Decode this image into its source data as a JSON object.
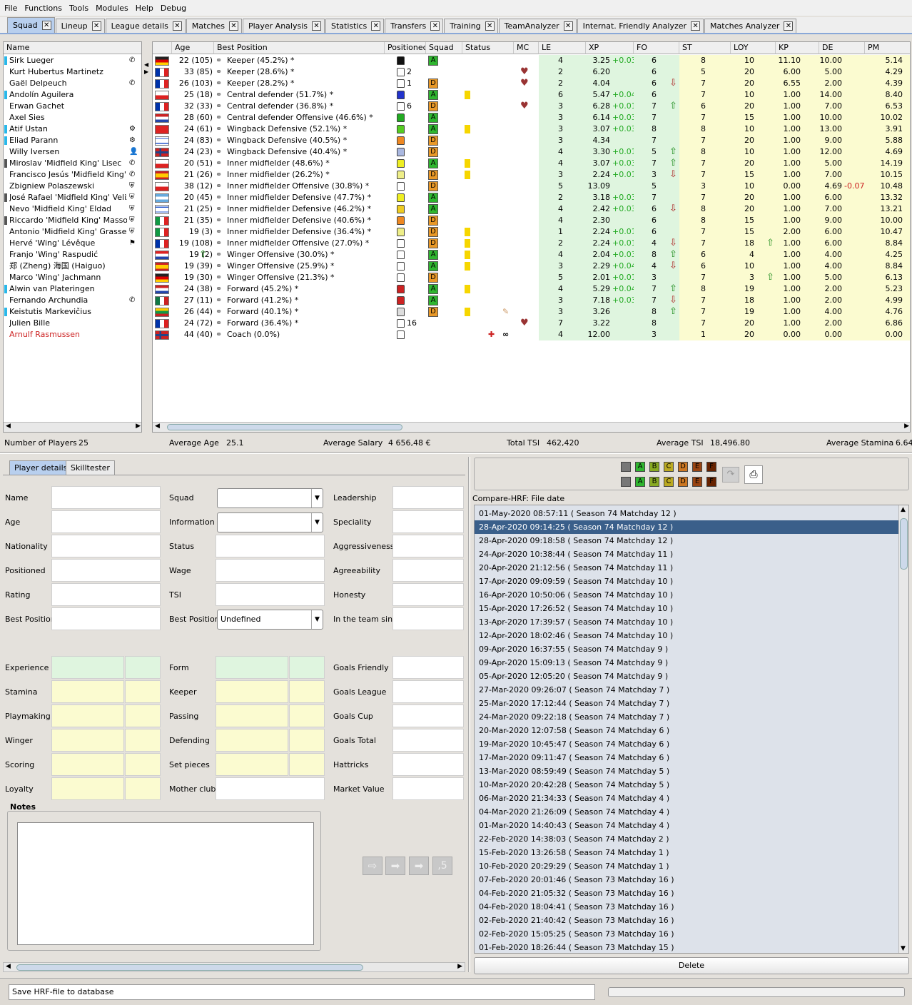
{
  "menu": [
    "File",
    "Functions",
    "Tools",
    "Modules",
    "Help",
    "Debug"
  ],
  "tabs": [
    "Squad",
    "Lineup",
    "League details",
    "Matches",
    "Player Analysis",
    "Statistics",
    "Transfers",
    "Training",
    "TeamAnalyzer",
    "Internat. Friendly Analyzer",
    "Matches Analyzer"
  ],
  "name_header": "Name",
  "columns": {
    "age": "Age",
    "best_position": "Best Position",
    "positioned": "Positioned",
    "squad": "Squad",
    "status": "Status",
    "mc": "MC",
    "le": "LE",
    "xp": "XP",
    "fo": "FO",
    "st": "ST",
    "loy": "LOY",
    "kp": "KP",
    "de": "DE",
    "pm": "PM"
  },
  "players": [
    {
      "name": "Sirk Lueger",
      "marker": "#29b7e8",
      "flag": "de",
      "age": "22 (105)",
      "best": "Keeper (45.2%) *",
      "shirt": "#111111",
      "num": "",
      "grp": "A",
      "card": false,
      "heart": false,
      "le": "4",
      "xp": "3.25",
      "xpd": "+0.03",
      "fo": "6",
      "fa": "",
      "st": "8",
      "loy": "10",
      "la": "",
      "kp": "11.10",
      "de": "10.00",
      "ded": "",
      "pm": "5.14"
    },
    {
      "name": "Kurt Hubertus Martinetz",
      "marker": "",
      "flag": "fr",
      "age": "33 (85)",
      "best": "Keeper (28.6%) *",
      "shirt": "#ffffff",
      "num": "2",
      "grp": "",
      "card": false,
      "heart": true,
      "le": "2",
      "xp": "6.20",
      "xpd": "",
      "fo": "6",
      "fa": "",
      "st": "5",
      "loy": "20",
      "la": "",
      "kp": "6.00",
      "de": "5.00",
      "ded": "",
      "pm": "4.29"
    },
    {
      "name": "Gaël Delpeuch",
      "marker": "",
      "flag": "fr",
      "age": "26 (103)",
      "best": "Keeper (28.2%) *",
      "shirt": "#ffffff",
      "num": "1",
      "grp": "D",
      "card": false,
      "heart": true,
      "le": "2",
      "xp": "4.04",
      "xpd": "",
      "fo": "6",
      "fa": "down",
      "st": "7",
      "loy": "20",
      "la": "",
      "kp": "6.55",
      "de": "2.00",
      "ded": "",
      "pm": "4.39"
    },
    {
      "name": "Andolín Aguilera",
      "marker": "#29b7e8",
      "flag": "cl",
      "age": "25 (18)",
      "best": "Central defender (51.7%) *",
      "shirt": "#2233cc",
      "num": "",
      "grp": "A",
      "card": true,
      "heart": false,
      "le": "6",
      "xp": "5.47",
      "xpd": "+0.04",
      "fo": "6",
      "fa": "",
      "st": "7",
      "loy": "10",
      "la": "",
      "kp": "1.00",
      "de": "14.00",
      "ded": "",
      "pm": "8.40"
    },
    {
      "name": "Erwan Gachet",
      "marker": "",
      "flag": "fr",
      "age": "32 (33)",
      "best": "Central defender (36.8%) *",
      "shirt": "#ffffff",
      "num": "6",
      "grp": "D",
      "card": false,
      "heart": true,
      "le": "3",
      "xp": "6.28",
      "xpd": "+0.01",
      "fo": "7",
      "fa": "up",
      "st": "6",
      "loy": "20",
      "la": "",
      "kp": "1.00",
      "de": "7.00",
      "ded": "",
      "pm": "6.53"
    },
    {
      "name": "Axel Sies",
      "marker": "",
      "flag": "nl",
      "age": "28 (60)",
      "best": "Central defender Offensive (46.6%) *",
      "shirt": "#22aa22",
      "num": "",
      "grp": "A",
      "card": false,
      "heart": false,
      "le": "3",
      "xp": "6.14",
      "xpd": "+0.03",
      "fo": "7",
      "fa": "",
      "st": "7",
      "loy": "15",
      "la": "",
      "kp": "1.00",
      "de": "10.00",
      "ded": "",
      "pm": "10.02"
    },
    {
      "name": "Atif Ustan",
      "marker": "#29b7e8",
      "flag": "tr",
      "age": "24 (61)",
      "best": "Wingback Defensive (52.1%) *",
      "shirt": "#55cc22",
      "num": "",
      "grp": "A",
      "card": true,
      "heart": false,
      "le": "3",
      "xp": "3.07",
      "xpd": "+0.03",
      "fo": "8",
      "fa": "",
      "st": "8",
      "loy": "10",
      "la": "",
      "kp": "1.00",
      "de": "13.00",
      "ded": "",
      "pm": "3.91"
    },
    {
      "name": "Eliad Parann",
      "marker": "#29b7e8",
      "flag": "il",
      "age": "24 (83)",
      "best": "Wingback Defensive (40.5%) *",
      "shirt": "#ee8822",
      "num": "",
      "grp": "D",
      "card": false,
      "heart": false,
      "le": "3",
      "xp": "4.34",
      "xpd": "",
      "fo": "7",
      "fa": "",
      "st": "7",
      "loy": "20",
      "la": "",
      "kp": "1.00",
      "de": "9.00",
      "ded": "",
      "pm": "5.88"
    },
    {
      "name": "Willy Iversen",
      "marker": "",
      "flag": "no",
      "age": "24 (23)",
      "best": "Wingback Defensive (40.4%) *",
      "shirt": "#aab8e0",
      "num": "",
      "grp": "D",
      "card": false,
      "heart": false,
      "le": "4",
      "xp": "3.30",
      "xpd": "+0.01",
      "fo": "5",
      "fa": "up",
      "st": "8",
      "loy": "10",
      "la": "",
      "kp": "1.00",
      "de": "12.00",
      "ded": "",
      "pm": "4.69"
    },
    {
      "name": "Miroslav 'Midfield King' Lisec",
      "marker": "#555555",
      "flag": "cz",
      "age": "20 (51)",
      "best": "Inner midfielder (48.6%) *",
      "shirt": "#eeee22",
      "num": "",
      "grp": "A",
      "card": true,
      "heart": false,
      "le": "4",
      "xp": "3.07",
      "xpd": "+0.03",
      "fo": "7",
      "fa": "up",
      "st": "7",
      "loy": "20",
      "la": "",
      "kp": "1.00",
      "de": "5.00",
      "ded": "",
      "pm": "14.19"
    },
    {
      "name": "Francisco Jesús 'Midfield King' ...",
      "marker": "",
      "flag": "es",
      "age": "21 (26)",
      "best": "Inner midfielder (26.2%) *",
      "shirt": "#eeee88",
      "num": "",
      "grp": "D",
      "card": true,
      "heart": false,
      "le": "3",
      "xp": "2.24",
      "xpd": "+0.01",
      "fo": "3",
      "fa": "down",
      "st": "7",
      "loy": "15",
      "la": "",
      "kp": "1.00",
      "de": "7.00",
      "ded": "",
      "pm": "10.15"
    },
    {
      "name": "Zbigniew Polaszewski",
      "marker": "",
      "flag": "pl",
      "age": "38 (12)",
      "best": "Inner midfielder Offensive (30.8%) *",
      "shirt": "#ffffff",
      "num": "",
      "grp": "D",
      "card": false,
      "heart": false,
      "le": "5",
      "xp": "13.09",
      "xpd": "",
      "fo": "5",
      "fa": "",
      "st": "3",
      "loy": "10",
      "la": "",
      "kp": "0.00",
      "de": "4.69",
      "ded": "-0.07",
      "pm": "10.48"
    },
    {
      "name": "José Rafael 'Midfield King' Veliz",
      "marker": "#555555",
      "flag": "ar",
      "age": "20 (45)",
      "best": "Inner midfielder Defensive (47.7%) *",
      "shirt": "#eeee22",
      "num": "",
      "grp": "A",
      "card": false,
      "heart": false,
      "le": "2",
      "xp": "3.18",
      "xpd": "+0.03",
      "fo": "7",
      "fa": "",
      "st": "7",
      "loy": "20",
      "la": "",
      "kp": "1.00",
      "de": "6.00",
      "ded": "",
      "pm": "13.32"
    },
    {
      "name": "Nevo 'Midfield King' Eldad",
      "marker": "",
      "flag": "il",
      "age": "21 (25)",
      "best": "Inner midfielder Defensive (46.2%) *",
      "shirt": "#eecc22",
      "num": "",
      "grp": "A",
      "card": false,
      "heart": false,
      "le": "4",
      "xp": "2.42",
      "xpd": "+0.03",
      "fo": "6",
      "fa": "down",
      "st": "8",
      "loy": "20",
      "la": "",
      "kp": "1.00",
      "de": "7.00",
      "ded": "",
      "pm": "13.21"
    },
    {
      "name": "Riccardo 'Midfield King' Massobrio",
      "marker": "#555555",
      "flag": "it",
      "age": "21 (35)",
      "best": "Inner midfielder Defensive (40.6%) *",
      "shirt": "#ee8822",
      "num": "",
      "grp": "D",
      "card": false,
      "heart": false,
      "le": "4",
      "xp": "2.30",
      "xpd": "",
      "fo": "6",
      "fa": "",
      "st": "8",
      "loy": "15",
      "la": "",
      "kp": "1.00",
      "de": "9.00",
      "ded": "",
      "pm": "10.00"
    },
    {
      "name": "Antonio 'Midfield King' Grasseni",
      "marker": "",
      "flag": "it",
      "age": "19 (3)",
      "best": "Inner midfielder Defensive (36.4%) *",
      "shirt": "#eeee88",
      "num": "",
      "grp": "D",
      "card": true,
      "heart": false,
      "le": "1",
      "xp": "2.24",
      "xpd": "+0.01",
      "fo": "6",
      "fa": "",
      "st": "7",
      "loy": "15",
      "la": "",
      "kp": "2.00",
      "de": "6.00",
      "ded": "",
      "pm": "10.47"
    },
    {
      "name": "Hervé 'Wing' Lévêque",
      "marker": "",
      "flag": "fr",
      "age": "19 (108)",
      "best": "Inner midfielder Offensive (27.0%) *",
      "shirt": "#ffffff",
      "num": "",
      "grp": "D",
      "card": true,
      "heart": false,
      "le": "2",
      "xp": "2.24",
      "xpd": "+0.01",
      "fo": "4",
      "fa": "down",
      "st": "7",
      "loy": "18",
      "la": "up",
      "kp": "1.00",
      "de": "6.00",
      "ded": "",
      "pm": "8.84"
    },
    {
      "name": "Franjo 'Wing' Raspudić",
      "marker": "",
      "flag": "hr",
      "age": "19 (2)",
      "best": "Winger Offensive (30.0%) *",
      "shirt": "#ffffff",
      "num": "",
      "grp": "A",
      "card": true,
      "heart": false,
      "le": "4",
      "xp": "2.04",
      "xpd": "+0.03",
      "fo": "8",
      "fa": "up",
      "st": "6",
      "loy": "4",
      "la": "",
      "kp": "1.00",
      "de": "4.00",
      "ded": "",
      "pm": "4.25"
    },
    {
      "name": "郑 (Zheng) 海国 (Haiguo)",
      "marker": "",
      "flag": "es",
      "age": "19 (39)",
      "best": "Winger Offensive (25.9%) *",
      "shirt": "#ffffff",
      "num": "",
      "grp": "A",
      "card": true,
      "heart": false,
      "le": "3",
      "xp": "2.29",
      "xpd": "+0.04",
      "fo": "4",
      "fa": "down",
      "st": "6",
      "loy": "10",
      "la": "",
      "kp": "1.00",
      "de": "4.00",
      "ded": "",
      "pm": "8.84"
    },
    {
      "name": "Marco 'Wing' Jachmann",
      "marker": "",
      "flag": "de",
      "age": "19 (30)",
      "best": "Winger Offensive (21.3%) *",
      "shirt": "#ffffff",
      "num": "",
      "grp": "D",
      "card": false,
      "heart": false,
      "le": "5",
      "xp": "2.01",
      "xpd": "+0.01",
      "fo": "3",
      "fa": "",
      "st": "7",
      "loy": "3",
      "la": "up",
      "kp": "1.00",
      "de": "5.00",
      "ded": "",
      "pm": "6.13"
    },
    {
      "name": "Alwin van Plateringen",
      "marker": "#29b7e8",
      "flag": "nl",
      "age": "24 (38)",
      "best": "Forward (45.2%) *",
      "shirt": "#cc2222",
      "num": "",
      "grp": "A",
      "card": true,
      "heart": false,
      "le": "4",
      "xp": "5.29",
      "xpd": "+0.04",
      "fo": "7",
      "fa": "up",
      "st": "8",
      "loy": "19",
      "la": "",
      "kp": "1.00",
      "de": "2.00",
      "ded": "",
      "pm": "5.23"
    },
    {
      "name": "Fernando Archundia",
      "marker": "",
      "flag": "mx",
      "age": "27 (11)",
      "best": "Forward (41.2%) *",
      "shirt": "#cc2222",
      "num": "",
      "grp": "A",
      "card": false,
      "heart": false,
      "le": "3",
      "xp": "7.18",
      "xpd": "+0.03",
      "fo": "7",
      "fa": "down",
      "st": "7",
      "loy": "18",
      "la": "",
      "kp": "1.00",
      "de": "2.00",
      "ded": "",
      "pm": "4.99"
    },
    {
      "name": "Keistutis Markevičius",
      "marker": "#29b7e8",
      "flag": "lt",
      "age": "26 (44)",
      "best": "Forward (40.1%) *",
      "shirt": "#dddddd",
      "num": "",
      "grp": "D",
      "card": true,
      "heart": false,
      "le": "3",
      "xp": "3.26",
      "xpd": "",
      "fo": "8",
      "fa": "up",
      "st": "7",
      "loy": "19",
      "la": "",
      "kp": "1.00",
      "de": "4.00",
      "ded": "",
      "pm": "4.76"
    },
    {
      "name": "Julien Bille",
      "marker": "",
      "flag": "fr",
      "age": "24 (72)",
      "best": "Forward (36.4%) *",
      "shirt": "#ffffff",
      "num": "16",
      "grp": "",
      "card": false,
      "heart": true,
      "le": "7",
      "xp": "3.22",
      "xpd": "",
      "fo": "8",
      "fa": "",
      "st": "7",
      "loy": "20",
      "la": "",
      "kp": "1.00",
      "de": "2.00",
      "ded": "",
      "pm": "6.86"
    },
    {
      "name": "Arnulf Rasmussen",
      "marker": "",
      "flag": "no",
      "age": "44 (40)",
      "best": "Coach (0.0%)",
      "shirt": "#ffffff",
      "num": "",
      "grp": "",
      "card": false,
      "heart": false,
      "le": "4",
      "xp": "12.00",
      "xpd": "",
      "fo": "3",
      "fa": "",
      "st": "1",
      "loy": "20",
      "la": "",
      "kp": "0.00",
      "de": "0.00",
      "ded": "",
      "pm": "0.00",
      "red": true,
      "cross": "✚",
      "inf": "∞"
    }
  ],
  "stats": {
    "players_label": "Number of Players",
    "players": "25",
    "age_label": "Average Age",
    "age": "25.1",
    "salary_label": "Average Salary",
    "salary": "4 656,48 €",
    "tsi_label": "Total TSI",
    "tsi": "462,420",
    "avg_tsi_label": "Average TSI",
    "avg_tsi": "18,496.80",
    "stamina_label": "Average Stamina",
    "stamina": "6.64"
  },
  "subtabs": [
    "Player details",
    "Skilltester"
  ],
  "details": {
    "col1": [
      "Name",
      "Age",
      "Nationality",
      "Positioned",
      "Rating",
      "Best Position"
    ],
    "col2": [
      "Squad",
      "Information",
      "Status",
      "Wage",
      "TSI",
      "Best Position"
    ],
    "col3": [
      "Leadership",
      "Speciality",
      "Aggressiveness",
      "Agreeability",
      "Honesty",
      "In the team since"
    ],
    "skills1": [
      "Experience",
      "Stamina",
      "Playmaking",
      "Winger",
      "Scoring",
      "Loyalty"
    ],
    "skills2": [
      "Form",
      "Keeper",
      "Passing",
      "Defending",
      "Set pieces",
      "Mother club"
    ],
    "skills3": [
      "Goals Friendly",
      "Goals League",
      "Goals Cup",
      "Goals Total",
      "Hattricks",
      "Market Value"
    ],
    "best_position_value": "Undefined",
    "notes_label": "Notes"
  },
  "compare_label": "Compare-HRF: File date",
  "filter_letters": [
    "A",
    "B",
    "C",
    "D",
    "E",
    "F"
  ],
  "hrf_files": [
    "01-May-2020 08:57:11 ( Season 74  Matchday 12 )",
    "28-Apr-2020 09:14:25 ( Season 74  Matchday 12 )",
    "28-Apr-2020 09:18:58 ( Season 74  Matchday 12 )",
    "24-Apr-2020 10:38:44 ( Season 74  Matchday 11 )",
    "20-Apr-2020 21:12:56 ( Season 74  Matchday 11 )",
    "17-Apr-2020 09:09:59 ( Season 74  Matchday 10 )",
    "16-Apr-2020 10:50:06 ( Season 74  Matchday 10 )",
    "15-Apr-2020 17:26:52 ( Season 74  Matchday 10 )",
    "13-Apr-2020 17:39:57 ( Season 74  Matchday 10 )",
    "12-Apr-2020 18:02:46 ( Season 74  Matchday 10 )",
    "09-Apr-2020 16:37:55 ( Season 74  Matchday 9 )",
    "09-Apr-2020 15:09:13 ( Season 74  Matchday 9 )",
    "05-Apr-2020 12:05:20 ( Season 74  Matchday 9 )",
    "27-Mar-2020 09:26:07 ( Season 74  Matchday 7 )",
    "25-Mar-2020 17:12:44 ( Season 74  Matchday 7 )",
    "24-Mar-2020 09:22:18 ( Season 74  Matchday 7 )",
    "20-Mar-2020 12:07:58 ( Season 74  Matchday 6 )",
    "19-Mar-2020 10:45:47 ( Season 74  Matchday 6 )",
    "17-Mar-2020 09:11:47 ( Season 74  Matchday 6 )",
    "13-Mar-2020 08:59:49 ( Season 74  Matchday 5 )",
    "10-Mar-2020 20:42:28 ( Season 74  Matchday 5 )",
    "06-Mar-2020 21:34:33 ( Season 74  Matchday 4 )",
    "04-Mar-2020 21:26:09 ( Season 74  Matchday 4 )",
    "01-Mar-2020 14:40:43 ( Season 74  Matchday 4 )",
    "22-Feb-2020 14:38:03 ( Season 74  Matchday 2 )",
    "15-Feb-2020 13:26:58 ( Season 74  Matchday 1 )",
    "10-Feb-2020 20:29:29 ( Season 74  Matchday 1 )",
    "07-Feb-2020 20:01:46 ( Season 73  Matchday 16 )",
    "04-Feb-2020 21:05:32 ( Season 73  Matchday 16 )",
    "04-Feb-2020 18:04:41 ( Season 73  Matchday 16 )",
    "02-Feb-2020 21:40:42 ( Season 73  Matchday 16 )",
    "02-Feb-2020 15:05:25 ( Season 73  Matchday 16 )",
    "01-Feb-2020 18:26:44 ( Season 73  Matchday 15 )"
  ],
  "selected_index": 1,
  "delete_label": "Delete",
  "status_message": "Save HRF-file to database",
  "arrow_num": ",5"
}
